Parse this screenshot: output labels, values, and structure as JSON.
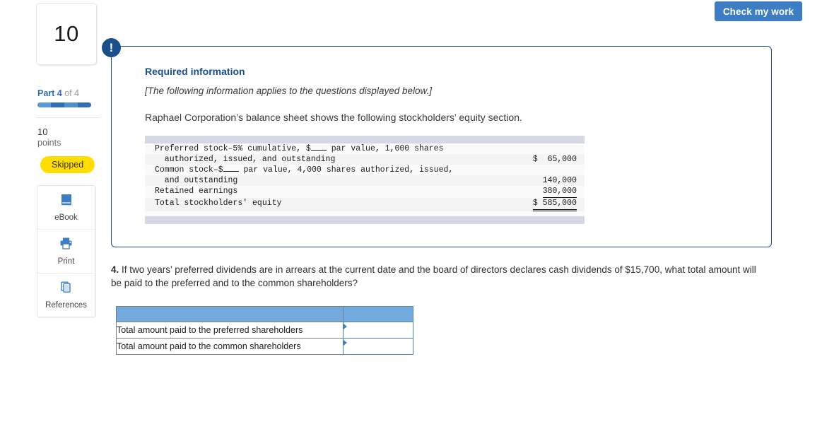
{
  "header": {
    "check_my_work_label": "Check my work"
  },
  "sidebar": {
    "question_number": "10",
    "part_prefix": "Part 4",
    "part_suffix": " of 4",
    "progress_segments": 4,
    "points_value": "10",
    "points_label": "points",
    "status_badge": "Skipped",
    "tools": [
      {
        "icon": "ebook-icon",
        "label": "eBook"
      },
      {
        "icon": "print-icon",
        "label": "Print"
      },
      {
        "icon": "references-icon",
        "label": "References"
      }
    ]
  },
  "info_card": {
    "badge": "!",
    "title": "Required information",
    "subtitle": "[The following information applies to the questions displayed below.]",
    "body": "Raphael Corporation’s balance sheet shows the following stockholders’ equity section."
  },
  "balance_sheet": {
    "rows": [
      {
        "desc_line1_a": "Preferred stock–5% cumulative, $",
        "desc_line1_b": " par value, 1,000 shares",
        "desc_line2": "  authorized, issued, and outstanding",
        "amount": "$  65,000",
        "rule": "none"
      },
      {
        "desc_line1_a": "Common stock–$",
        "desc_line1_b": " par value, 4,000 shares authorized, issued,",
        "desc_line2": "  and outstanding",
        "amount": "140,000",
        "rule": "none"
      },
      {
        "desc_line1_a": "Retained earnings",
        "desc_line1_b": "",
        "desc_line2": "",
        "amount": "380,000",
        "rule": "single"
      },
      {
        "desc_line1_a": "Total stockholders' equity",
        "desc_line1_b": "",
        "desc_line2": "",
        "amount": "$ 585,000",
        "rule": "double"
      }
    ]
  },
  "question": {
    "number": "4.",
    "text": " If two years’ preferred dividends are in arrears at the current date and the board of directors declares cash dividends of $15,700, what total amount will be paid to the preferred and to the common shareholders?"
  },
  "answer_table": {
    "header_left": "",
    "header_right": "",
    "rows": [
      {
        "label": "Total amount paid to the preferred shareholders",
        "value": ""
      },
      {
        "label": "Total amount paid to the common shareholders",
        "value": ""
      }
    ]
  },
  "colors": {
    "accent_blue": "#3c7dc4",
    "navy": "#1b4f8a",
    "table_header_blue": "#74a9dd",
    "badge_yellow": "#ffdd00",
    "band_gray": "#d3d8e2"
  }
}
